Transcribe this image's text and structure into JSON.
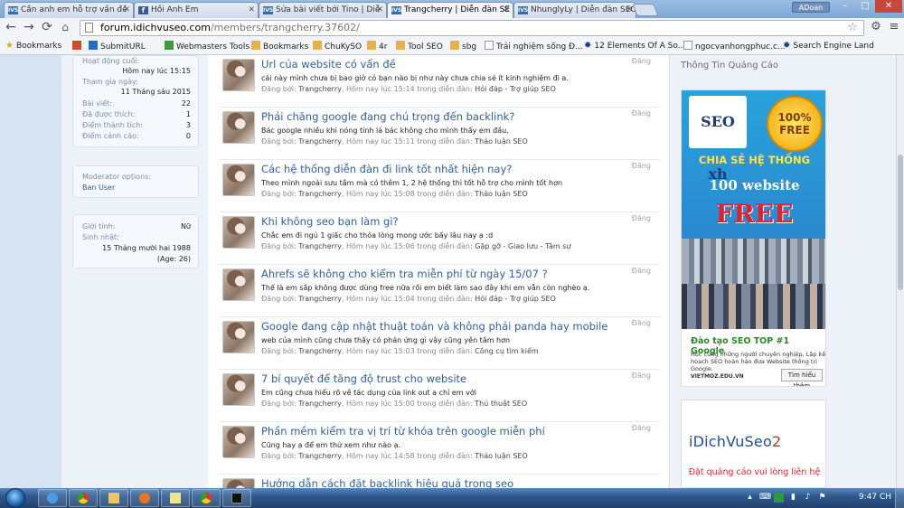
{
  "browser": {
    "tabs": [
      {
        "label": "Cần anh em hỗ trợ vấn đề",
        "icon": "inkscape-favicon-icon"
      },
      {
        "label": "Hồi Anh Em",
        "icon": "facebook-icon"
      },
      {
        "label": "Sửa bài viết bởi Tino | Diễ",
        "icon": "inkscape-favicon-icon"
      },
      {
        "label": "Trangcherry | Diễn đàn SE",
        "icon": "inkscape-favicon-icon"
      },
      {
        "label": "NhunglyLy | Diễn đàn SEO c",
        "icon": "inkscape-favicon-icon"
      }
    ],
    "user_badge": "ADoan",
    "address": {
      "host": "forum.idichvuseo.com",
      "path": "/members/trangcherry.37602/"
    },
    "bookmarks": [
      {
        "label": "Bookmarks",
        "icon": "star"
      },
      {
        "label": "",
        "icon": "red"
      },
      {
        "label": "SubmitURL",
        "icon": "blue"
      },
      {
        "label": "Webmasters Tools",
        "icon": "green"
      },
      {
        "label": "Bookmarks",
        "icon": "folder"
      },
      {
        "label": "ChuKySO",
        "icon": "folder"
      },
      {
        "label": "4r",
        "icon": "folder"
      },
      {
        "label": "Tool SEO",
        "icon": "folder"
      },
      {
        "label": "sbg",
        "icon": "folder"
      },
      {
        "label": "Trải nghiệm sống Đ...",
        "icon": "page"
      },
      {
        "label": "12 Elements Of A So...",
        "icon": "gear"
      },
      {
        "label": "ngocvanhongphuc.c...",
        "icon": "page"
      },
      {
        "label": "Search Engine Land",
        "icon": "gear"
      }
    ]
  },
  "profile": {
    "stats": [
      {
        "label": "Hoạt động cuối:",
        "value": "Hôm nay lúc 15:15"
      },
      {
        "label": "Tham gia ngày:",
        "value": "11 Tháng sáu 2015"
      },
      {
        "label": "Bài viết:",
        "value": "22"
      },
      {
        "label": "Đã được thích:",
        "value": "1"
      },
      {
        "label": "Điểm thành tích:",
        "value": "3"
      },
      {
        "label": "Điểm cảnh cáo:",
        "value": "0"
      }
    ],
    "moderator_label": "Moderator options:",
    "moderator_link": "Ban User",
    "gender_label": "Giới tính:",
    "gender_value": "Nữ",
    "birthday_label": "Sinh nhật:",
    "birthday_value": "15 Tháng mười hai 1988",
    "age_value": "(Age: 26)"
  },
  "feed": {
    "items": [
      {
        "title": "Url của website có vấn đề",
        "snippet": "cái này mình chưa bị bao giờ có bạn nào bị như này chưa chia sẻ ít kinh nghiệm đi a.",
        "posted_by": "Đăng bởi:",
        "user": "Trangcherry",
        "time": "Hôm nay lúc 15:14 trong diễn đàn:",
        "forum": "Hỏi đáp - Trợ giúp SEO",
        "action": "Đăng"
      },
      {
        "title": "Phải chăng google đang chú trọng đến backlink?",
        "snippet": "Bác google nhiều khi nóng tính lá bác không cho mình thấy em đầu.",
        "posted_by": "Đăng bởi:",
        "user": "Trangcherry",
        "time": "Hôm nay lúc 15:11 trong diễn đàn:",
        "forum": "Thảo luận SEO",
        "action": "Đăng"
      },
      {
        "title": "Các hệ thống diễn đàn đi link tốt nhất hiện nay?",
        "snippet": "Theo mình ngoài sưu tầm mà có thêm 1, 2 hệ thống thì tốt hỗ trợ cho mình tốt hơn",
        "posted_by": "Đăng bởi:",
        "user": "Trangcherry",
        "time": "Hôm nay lúc 15:08 trong diễn đàn:",
        "forum": "Thảo luận SEO",
        "action": "Đăng"
      },
      {
        "title": "Khi không seo bạn làm gì?",
        "snippet": "Chắc em đi ngủ 1 giấc cho thỏa lòng mong ước bấy lâu nay ạ :d",
        "posted_by": "Đăng bởi:",
        "user": "Trangcherry",
        "time": "Hôm nay lúc 15:06 trong diễn đàn:",
        "forum": "Gặp gỡ - Giao lưu - Tâm sự",
        "action": "Đăng"
      },
      {
        "title": "Ahrefs sẽ không cho kiểm tra miễn phí từ ngày 15/07 ?",
        "snippet": "Thế là em sắp không được dùng free nữa rồi em biết làm sao đây khi em vẫn còn nghèo ạ.",
        "posted_by": "Đăng bởi:",
        "user": "Trangcherry",
        "time": "Hôm nay lúc 15:04 trong diễn đàn:",
        "forum": "Hỏi đáp - Trợ giúp SEO",
        "action": "Đăng"
      },
      {
        "title": "Google đang cập nhật thuật toán và không phải panda hay mobile",
        "snippet": "web của mình cũng chưa thấy có phản ứng gì vậy cũng yên tâm hơn",
        "posted_by": "Đăng bởi:",
        "user": "Trangcherry",
        "time": "Hôm nay lúc 15:03 trong diễn đàn:",
        "forum": "Công cụ tìm kiếm",
        "action": "Đăng"
      },
      {
        "title": "7 bí quyết để tăng độ trust cho website",
        "snippet": "Em cũng chưa hiểu rõ về tác dụng của link out a chỉ em với",
        "posted_by": "Đăng bởi:",
        "user": "Trangcherry",
        "time": "Hôm nay lúc 15:00 trong diễn đàn:",
        "forum": "Thủ thuật SEO",
        "action": "Đăng"
      },
      {
        "title": "Phần mềm kiểm tra vị trí từ khóa trên google miễn phí",
        "snippet": "Cũng hay ạ để em thử xem như nào ạ.",
        "posted_by": "Đăng bởi:",
        "user": "Trangcherry",
        "time": "Hôm nay lúc 14:58 trong diễn đàn:",
        "forum": "Thảo luận SEO",
        "action": "Đăng"
      },
      {
        "title": "Hướng dẫn cách đặt backlink hiệu quả trong seo",
        "snippet": "",
        "posted_by": "",
        "user": "",
        "time": "",
        "forum": "",
        "action": ""
      }
    ]
  },
  "sidebar": {
    "heading": "Thông Tin Quảng Cáo",
    "ad1": {
      "logo": "SEO xh",
      "badge": "100% FREE",
      "line1": "CHIA SẺ HỆ THỐNG",
      "line2": "100 website",
      "line3": "FREE",
      "cta_title": "Đào tạo SEO TOP #1 Google",
      "cta_desc": "Học cùng những người chuyên nghiệp, Lập kế hoạch SEO hoàn hảo đưa Website thống trị Google.",
      "cta_url": "VIETMOZ.EDU.VN",
      "cta_button": "Tìm hiểu thêm"
    },
    "ad2": {
      "logo_main": "iDichVuSeo",
      "logo_accent": "2",
      "text": "Đặt quảng cáo vui lòng liên hệ"
    }
  },
  "taskbar": {
    "clock": "9:47 CH"
  },
  "colors": {
    "link": "#2f5fa8",
    "accent_red": "#d62a2a",
    "chrome_frame": "#7fa7d4"
  }
}
